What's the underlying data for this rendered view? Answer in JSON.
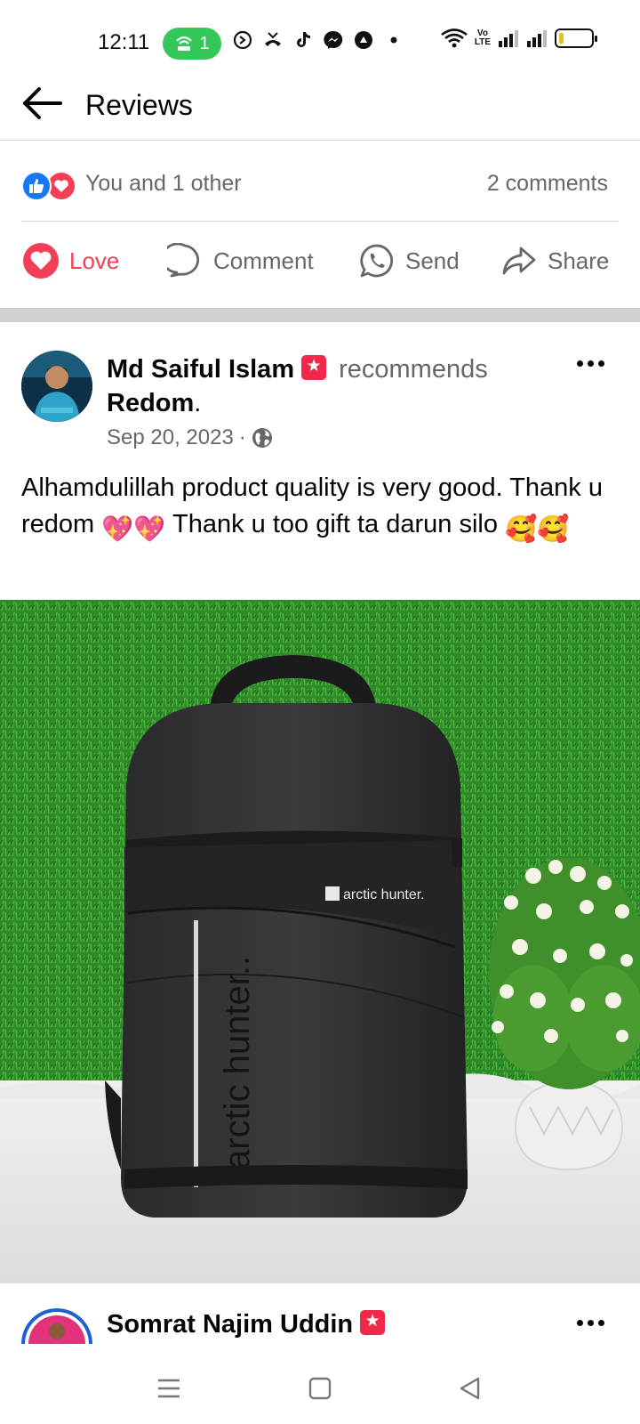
{
  "status_bar": {
    "time": "12:11",
    "hotspot_count": "1",
    "volte_line1": "Vo",
    "volte_line2": "LTE",
    "battery_level": 0.15
  },
  "header": {
    "title": "Reviews"
  },
  "reactions": {
    "summary": "You and 1 other",
    "comments": "2 comments"
  },
  "actions": {
    "love": "Love",
    "comment": "Comment",
    "send": "Send",
    "share": "Share"
  },
  "post": {
    "author": "Md Saiful Islam",
    "recommends": "recommends",
    "page": "Redom",
    "date": "Sep 20, 2023",
    "text_part1": "Alhamdulillah product quality is very good. Thank u redom ",
    "emoji1": "💖💖",
    "text_part2": " Thank u too gift ta darun silo ",
    "emoji2": "🥰🥰",
    "photo_brand": "arctic hunter.",
    "photo_side_text": "arctic hunter.."
  },
  "next_review": {
    "author": "Somrat Najim Uddin"
  },
  "colors": {
    "like": "#1877f2",
    "love": "#f33e58",
    "secondary_text": "#65676b",
    "separator": "#ced0d4",
    "hotspot": "#34c759"
  }
}
